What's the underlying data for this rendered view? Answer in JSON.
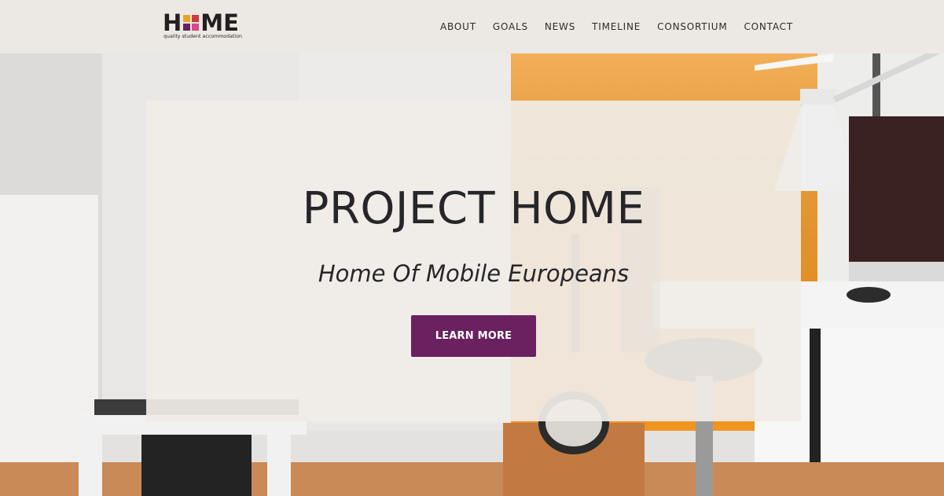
{
  "header": {
    "logo": {
      "text_left": "H",
      "text_right": "ME",
      "tagline": "quality student accommodation",
      "square_colors": [
        "#e8a427",
        "#d13a3f",
        "#6a2160",
        "#e0458e"
      ]
    },
    "nav": [
      {
        "label": "ABOUT"
      },
      {
        "label": "GOALS"
      },
      {
        "label": "NEWS"
      },
      {
        "label": "TIMELINE"
      },
      {
        "label": "CONSORTIUM"
      },
      {
        "label": "CONTACT"
      }
    ]
  },
  "hero": {
    "title": "PROJECT HOME",
    "subtitle": "Home Of Mobile Europeans",
    "button_label": "LEARN MORE",
    "accent_color": "#6a2160",
    "background_image": "photo of a bright room with a white desk, lamp, monitor, office chair, guitar and an orange wall"
  }
}
